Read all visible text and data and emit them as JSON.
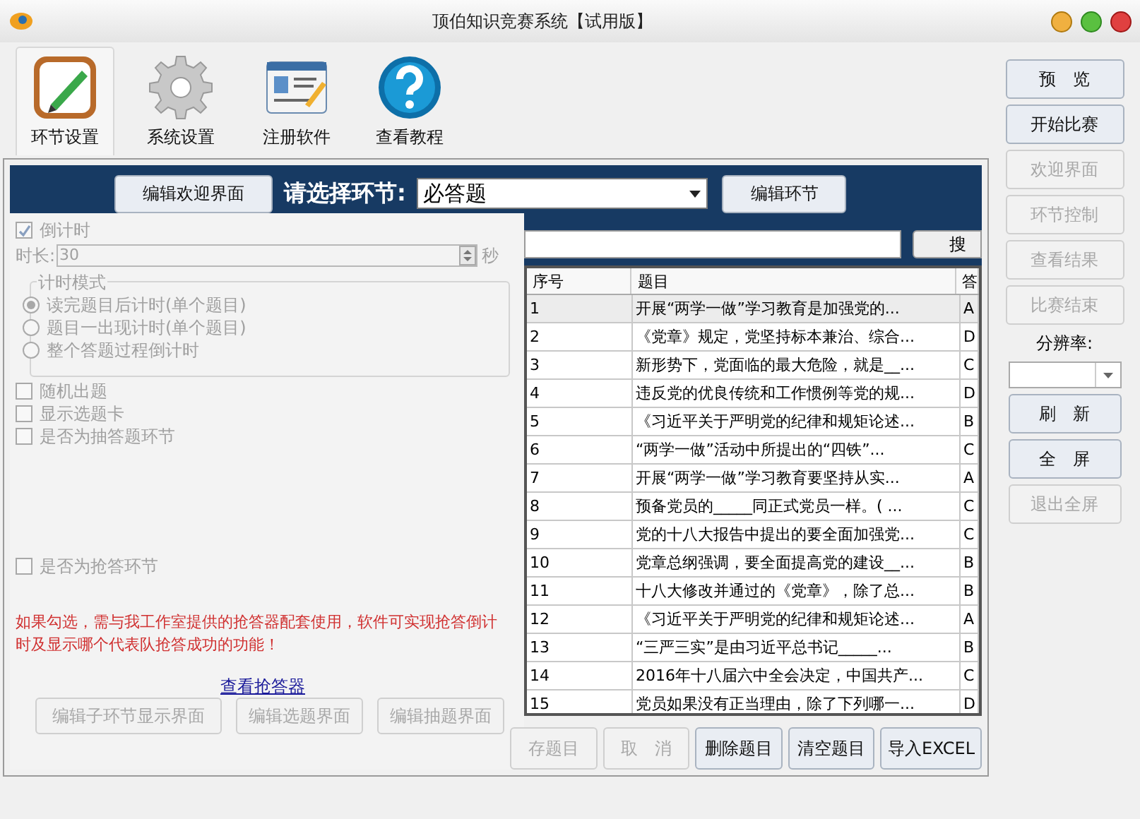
{
  "window": {
    "title": "顶伯知识竞赛系统【试用版】"
  },
  "toolbar": [
    {
      "label": "环节设置",
      "kind": "pencil",
      "selected": true
    },
    {
      "label": "系统设置",
      "kind": "gear",
      "selected": false
    },
    {
      "label": "注册软件",
      "kind": "card",
      "selected": false
    },
    {
      "label": "查看教程",
      "kind": "help",
      "selected": false
    }
  ],
  "header": {
    "edit_welcome_button": "编辑欢迎界面",
    "prompt": "请选择环节:",
    "round_select": "必答题",
    "edit_round_button": "编辑环节"
  },
  "settings": {
    "countdown": {
      "label": "倒计时",
      "checked": true
    },
    "duration_label": "时长:",
    "duration": "30",
    "unit": "秒",
    "group_title": "计时模式",
    "modes": [
      {
        "label": "读完题目后计时(单个题目)",
        "selected": true
      },
      {
        "label": "题目一出现计时(单个题目)",
        "selected": false
      },
      {
        "label": "整个答题过程倒计时",
        "selected": false
      }
    ],
    "options": [
      {
        "label": "随机出题",
        "checked": false
      },
      {
        "label": "显示选题卡",
        "checked": false
      },
      {
        "label": "是否为抽答题环节",
        "checked": false
      }
    ],
    "buzzer_option": {
      "label": "是否为抢答环节",
      "checked": false
    },
    "note": "如果勾选，需与我工作室提供的抢答器配套使用，软件可实现抢答倒计时及显示哪个代表队抢答成功的功能！",
    "link": "查看抢答器",
    "buttons": [
      "编辑子环节显示界面",
      "编辑选题界面",
      "编辑抽题界面"
    ]
  },
  "search": {
    "button": "搜"
  },
  "table": {
    "columns": [
      "序号",
      "题目",
      "答"
    ],
    "rows": [
      {
        "cells": [
          "1",
          "开展“两学一做”学习教育是加强党的...",
          "A"
        ],
        "selected": true
      },
      {
        "cells": [
          "2",
          "《党章》规定，党坚持标本兼治、综合...",
          "D"
        ],
        "selected": false
      },
      {
        "cells": [
          "3",
          "新形势下，党面临的最大危险，就是__...",
          "C"
        ],
        "selected": false
      },
      {
        "cells": [
          "4",
          "违反党的优良传统和工作惯例等党的规...",
          "D"
        ],
        "selected": false
      },
      {
        "cells": [
          "5",
          "《习近平关于严明党的纪律和规矩论述...",
          "B"
        ],
        "selected": false
      },
      {
        "cells": [
          "6",
          "“两学一做”活动中所提出的“四铁”...",
          "C"
        ],
        "selected": false
      },
      {
        "cells": [
          "7",
          "开展“两学一做”学习教育要坚持从实...",
          "A"
        ],
        "selected": false
      },
      {
        "cells": [
          "8",
          "预备党员的_____同正式党员一样。( ...",
          "C"
        ],
        "selected": false
      },
      {
        "cells": [
          "9",
          "党的十八大报告中提出的要全面加强党...",
          "C"
        ],
        "selected": false
      },
      {
        "cells": [
          "10",
          "党章总纲强调，要全面提高党的建设__...",
          "B"
        ],
        "selected": false
      },
      {
        "cells": [
          "11",
          "十八大修改并通过的《党章》，除了总...",
          "B"
        ],
        "selected": false
      },
      {
        "cells": [
          "12",
          "《习近平关于严明党的纪律和规矩论述...",
          "A"
        ],
        "selected": false
      },
      {
        "cells": [
          "13",
          "“三严三实”是由习近平总书记_____...",
          "B"
        ],
        "selected": false
      },
      {
        "cells": [
          "14",
          "2016年十八届六中全会决定，中国共产...",
          "C"
        ],
        "selected": false
      },
      {
        "cells": [
          "15",
          "党员如果没有正当理由，除了下列哪一...",
          "D"
        ],
        "selected": false
      }
    ]
  },
  "table_buttons": [
    {
      "label": "存题目",
      "disabled": true
    },
    {
      "label": "取　消",
      "disabled": true
    },
    {
      "label": "删除题目",
      "disabled": false
    },
    {
      "label": "清空题目",
      "disabled": false
    },
    {
      "label": "导入EXCEL",
      "disabled": false
    }
  ],
  "side": {
    "top_buttons": [
      {
        "label": "预　览",
        "disabled": false
      },
      {
        "label": "开始比赛",
        "disabled": false
      },
      {
        "label": "欢迎界面",
        "disabled": true
      },
      {
        "label": "环节控制",
        "disabled": true
      },
      {
        "label": "查看结果",
        "disabled": true
      },
      {
        "label": "比赛结束",
        "disabled": true
      }
    ],
    "resolution_label": "分辨率:",
    "bottom_buttons": [
      {
        "label": "刷　新",
        "disabled": false
      },
      {
        "label": "全　屏",
        "disabled": false
      },
      {
        "label": "退出全屏",
        "disabled": true
      }
    ]
  }
}
